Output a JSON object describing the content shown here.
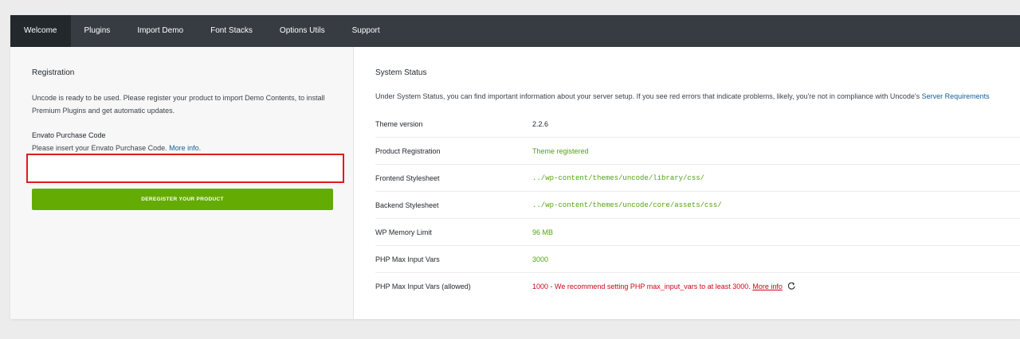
{
  "nav": {
    "tabs": [
      {
        "label": "Welcome"
      },
      {
        "label": "Plugins"
      },
      {
        "label": "Import Demo"
      },
      {
        "label": "Font Stacks"
      },
      {
        "label": "Options Utils"
      },
      {
        "label": "Support"
      }
    ]
  },
  "registration": {
    "title": "Registration",
    "intro": "Uncode is ready to be used. Please register your product to import Demo Contents, to install Premium Plugins and get automatic updates.",
    "purchase_code_label": "Envato Purchase Code",
    "purchase_code_help": "Please insert your Envato Purchase Code.",
    "more_info_link": "More info.",
    "purchase_code_value": "",
    "deregister_button": "DEREGISTER YOUR PRODUCT"
  },
  "system_status": {
    "title": "System Status",
    "description": "Under System Status, you can find important information about your server setup. If you see red errors that indicate problems, likely, you're not in compliance with Uncode's",
    "requirements_link": "Server Requirements",
    "rows": [
      {
        "key": "Theme version",
        "value": "2.2.6"
      },
      {
        "key": "Product Registration",
        "value": "Theme registered"
      },
      {
        "key": "Frontend Stylesheet",
        "value": "../wp-content/themes/uncode/library/css/"
      },
      {
        "key": "Backend Stylesheet",
        "value": "../wp-content/themes/uncode/core/assets/css/"
      },
      {
        "key": "WP Memory Limit",
        "value": "96 MB"
      },
      {
        "key": "PHP Max Input Vars",
        "value": "3000"
      },
      {
        "key": "PHP Max Input Vars (allowed)",
        "value": "1000 - We recommend setting PHP max_input_vars to at least 3000.",
        "link": "More info",
        "icon": "refresh-icon"
      }
    ]
  },
  "colors": {
    "nav_bg": "#373c42",
    "nav_active": "#23282d",
    "accent_green": "#64ac04",
    "ok_text": "#52a310",
    "error_text": "#d0021b",
    "link": "#135e96",
    "input_border": "#e0191f"
  }
}
